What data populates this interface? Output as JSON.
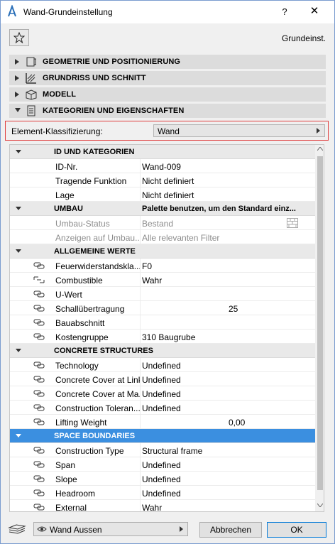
{
  "window": {
    "title": "Wand-Grundeinstellung",
    "help": "?",
    "close": "✕"
  },
  "preset_label": "Grundeinst.",
  "sections": [
    {
      "label": "GEOMETRIE UND POSITIONIERUNG",
      "expanded": false
    },
    {
      "label": "GRUNDRISS UND SCHNITT",
      "expanded": false
    },
    {
      "label": "MODELL",
      "expanded": false
    },
    {
      "label": "KATEGORIEN UND EIGENSCHAFTEN",
      "expanded": true
    }
  ],
  "classification": {
    "label": "Element-Klassifizierung:",
    "value": "Wand",
    "highlight": "#e03c3c"
  },
  "groups": {
    "id": {
      "name": "ID UND KATEGORIEN"
    },
    "umbau": {
      "name": "UMBAU",
      "value": "Palette benutzen, um den Standard einz..."
    },
    "allg": {
      "name": "ALLGEMEINE WERTE"
    },
    "concrete": {
      "name": "CONCRETE STRUCTURES"
    },
    "space": {
      "name": "SPACE BOUNDARIES"
    }
  },
  "rows": {
    "idnr": {
      "name": "ID-Nr.",
      "value": "Wand-009"
    },
    "tragend": {
      "name": "Tragende Funktion",
      "value": "Nicht definiert"
    },
    "lage": {
      "name": "Lage",
      "value": "Nicht definiert"
    },
    "umbaustatus": {
      "name": "Umbau-Status",
      "value": "Bestand"
    },
    "anzeigen": {
      "name": "Anzeigen auf Umbau...",
      "value": "Alle relevanten Filter"
    },
    "feuer": {
      "name": "Feuerwiderstandskla...",
      "value": "F0"
    },
    "combustible": {
      "name": "Combustible",
      "value": "Wahr"
    },
    "uwert": {
      "name": "U-Wert",
      "value": ""
    },
    "schall": {
      "name": "Schallübertragung",
      "value": "25"
    },
    "bauabschnitt": {
      "name": "Bauabschnitt",
      "value": ""
    },
    "kosten": {
      "name": "Kostengruppe",
      "value": "310 Baugrube"
    },
    "technology": {
      "name": "Technology",
      "value": "Undefined"
    },
    "cover_links": {
      "name": "Concrete Cover at Links",
      "value": "Undefined"
    },
    "cover_ma": {
      "name": "Concrete Cover at Ma...",
      "value": "Undefined"
    },
    "tolerance": {
      "name": "Construction Toleran...",
      "value": "Undefined"
    },
    "lifting": {
      "name": "Lifting Weight",
      "value": "0,00"
    },
    "ctype": {
      "name": "Construction Type",
      "value": "Structural frame"
    },
    "span": {
      "name": "Span",
      "value": "Undefined"
    },
    "slope": {
      "name": "Slope",
      "value": "Undefined"
    },
    "headroom": {
      "name": "Headroom",
      "value": "Undefined"
    },
    "external": {
      "name": "External",
      "value": "Wahr"
    }
  },
  "footer": {
    "view": "Wand Aussen",
    "cancel": "Abbrechen",
    "ok": "OK"
  },
  "colors": {
    "selection": "#3b8fe0",
    "group_bg": "#e9e9e9",
    "ok_border": "#0078d7"
  }
}
